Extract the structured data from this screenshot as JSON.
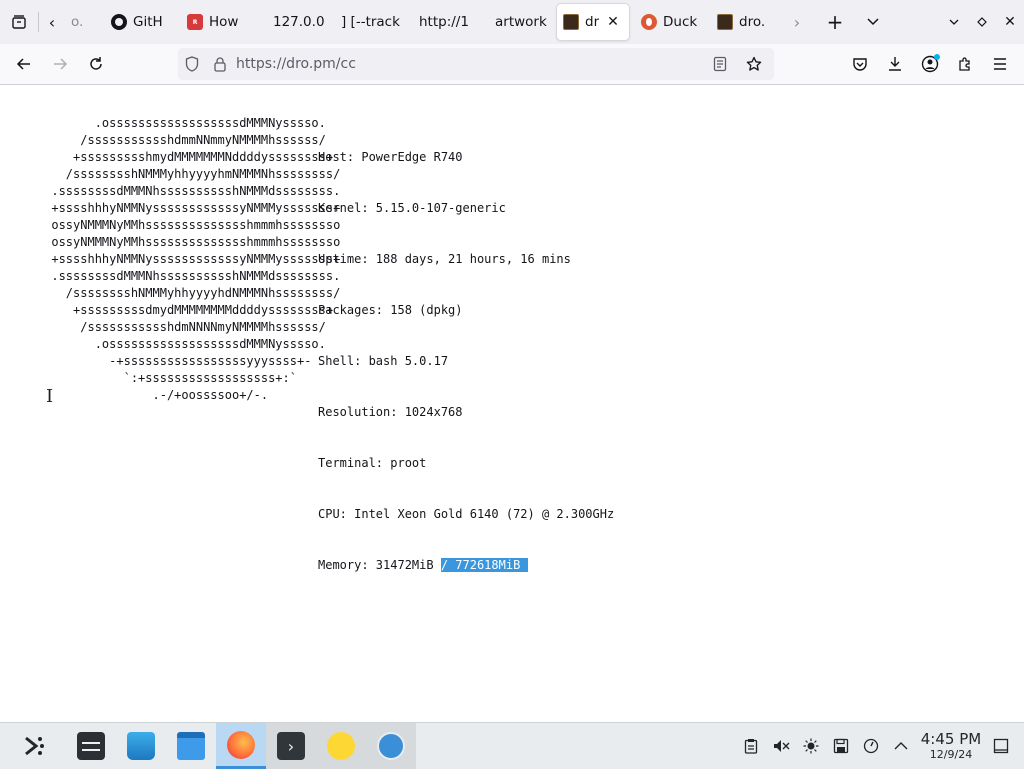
{
  "tabs": [
    {
      "label": "o.",
      "favicon": "generic",
      "active": false
    },
    {
      "label": "GitH",
      "favicon": "github-icon",
      "active": false
    },
    {
      "label": "How",
      "favicon": "red-badge",
      "active": false
    },
    {
      "label": "127.0.0",
      "favicon": "none",
      "active": false
    },
    {
      "label": "] [--track",
      "favicon": "none",
      "active": false
    },
    {
      "label": "http://1",
      "favicon": "none",
      "active": false
    },
    {
      "label": "artwork",
      "favicon": "none",
      "active": false
    },
    {
      "label": "dr",
      "favicon": "terminal-image",
      "active": true
    },
    {
      "label": "Duck",
      "favicon": "duckduckgo-icon",
      "active": false
    },
    {
      "label": "dro.",
      "favicon": "terminal-image",
      "active": false
    }
  ],
  "url": {
    "text": "https://dro.pm/cc"
  },
  "neofetch": {
    "ascii": "            .ossssssssssssssssssdMMMNysssso.\n          /ssssssssssshdmmNNmmyNMMMMhssssss/\n         +ssssssssshmydMMMMMMMNddddyssssssss+\n        /sssssssshNMMMyhhyyyyhmNMMMNhssssssss/\n      .ssssssssdMMMNhsssssssssshNMMMdssssssss.\n      +sssshhhyNMMNyssssssssssssyNMMMysssssss+\n      ossyNMMMNyMMhsssssssssssssshmmmhssssssso\n      ossyNMMMNyMMhsssssssssssssshmmmhssssssso\n      +sssshhhyNMMNyssssssssssssyNMMMysssssss+\n      .ssssssssdMMMNhsssssssssshNMMMdssssssss.\n        /sssssssshNMMMyhhyyyyhdNMMMNhssssssss/\n         +sssssssssdmydMMMMMMMMddddyssssssss+\n          /ssssssssssshdmNNNNmyNMMMMhssssss/\n            .ossssssssssssssssssdMMMNysssso.\n              -+sssssssssssssssssyyyssss+-\n                `:+ssssssssssssssssss+:`\n                    .-/+oossssoo+/-.",
    "host": "Host: PowerEdge R740",
    "kernel": "Kernel: 5.15.0-107-generic",
    "uptime": "Uptime: 188 days, 21 hours, 16 mins",
    "packages": "Packages: 158 (dpkg)",
    "shell": "Shell: bash 5.0.17",
    "resolution": "Resolution: 1024x768",
    "terminal": "Terminal: proot",
    "cpu": "CPU: Intel Xeon Gold 6140 (72) @ 2.300GHz",
    "memory_label": "Memory: 31472MiB ",
    "memory_selected": "/ 772618MiB "
  },
  "taskbar": {
    "apps": [
      "app-launcher-icon",
      "system-settings-icon",
      "discover-store-icon",
      "file-manager-icon",
      "firefox-icon",
      "terminal-icon",
      "emoji-icon",
      "browser-globe-icon"
    ],
    "active_app": "firefox-icon"
  },
  "clock": {
    "time": "4:45 PM",
    "date": "12/9/24"
  },
  "colors": {
    "selection": "#3a96dd",
    "accent": "#3b8fd6",
    "firefox": "#ff7139"
  }
}
